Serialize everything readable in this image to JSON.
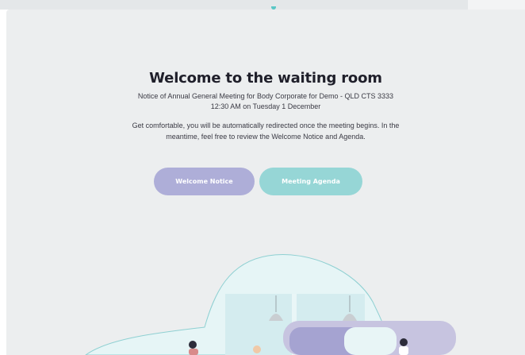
{
  "waiting_room": {
    "title": "Welcome to the waiting room",
    "meeting_notice": "Notice of Annual General Meeting for Body Corporate for Demo - QLD CTS 3333",
    "meeting_time": "12:30 AM on Tuesday 1 December",
    "intro_text": "Get comfortable, you will be automatically redirected once the meeting begins. In the meantime, feel free to review the Welcome Notice and Agenda."
  },
  "actions": {
    "welcome_notice_label": "Welcome Notice",
    "meeting_agenda_label": "Meeting Agenda"
  },
  "colors": {
    "welcome_button": "#aeaed8",
    "agenda_button": "#96d6d6",
    "accent": "#5ac7c6"
  }
}
